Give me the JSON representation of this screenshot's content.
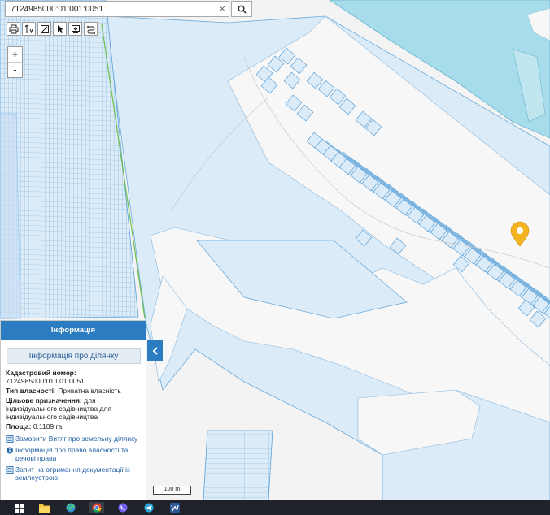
{
  "search": {
    "value": "7124985000:01:001:0051",
    "clear_icon": "close-icon",
    "button_icon": "search-icon"
  },
  "toolbar": {
    "icons": [
      "print-icon",
      "measure-length-icon",
      "measure-area-icon",
      "pointer-icon",
      "export-icon",
      "layers-icon"
    ]
  },
  "zoom": {
    "in_label": "+",
    "out_label": "-"
  },
  "info_panel": {
    "header": "Інформація",
    "subheader": "Інформація про ділянку",
    "cadastral_label": "Кадастровий номер:",
    "cadastral_value": "7124985000:01:001:0051",
    "ownership_label": "Тип власності:",
    "ownership_value": "Приватна власність",
    "purpose_label": "Цільове призначення:",
    "purpose_value": "для індивідуального садівництва для індивідуального садівництва",
    "area_label": "Площа:",
    "area_value": "0.1109 га",
    "links": [
      "Замовити Витяг про земельну ділянку",
      "Інформація про право власності та речові права",
      "Запит на отримання документації із землеустрою"
    ]
  },
  "scale_bar": {
    "label": "100 m"
  },
  "colors": {
    "parcel_fill": "#dbeaf8",
    "parcel_stroke": "#5aa1d8",
    "water": "#a7dcea",
    "marker": "#f4b41f",
    "panel_header": "#2b7cc1"
  },
  "taskbar": {
    "icons": [
      "windows-start-icon",
      "file-explorer-icon",
      "edge-icon",
      "chrome-icon",
      "viber-icon",
      "telegram-icon",
      "word-icon"
    ]
  }
}
